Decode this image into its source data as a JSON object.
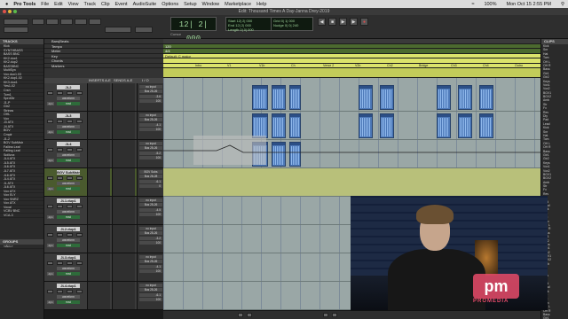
{
  "menubar": {
    "items": [
      "Pro Tools",
      "File",
      "Edit",
      "View",
      "Track",
      "Clip",
      "Event",
      "AudioSuite",
      "Options",
      "Setup",
      "Window",
      "Marketplace",
      "Help"
    ],
    "battery": "100%",
    "clock": "Mon Oct 15 2:55 PM"
  },
  "window": {
    "title": "Edit: Thousand Times A Day-Janna Drey-2019"
  },
  "toolbar": {
    "main_counter": "12| 2| 000",
    "start_label": "Start",
    "end_label": "End",
    "length_label": "Length",
    "start_value": "12| 2| 000",
    "end_value": "12| 2| 000",
    "length_value": "0| 0| 000",
    "grid_label": "Grid",
    "nudge_label": "Nudge",
    "grid_value": "0| 1| 000",
    "nudge_value": "0| 0| 240",
    "cursor_label": "Cursor"
  },
  "tracks_panel": {
    "header": "TRACKS",
    "items": [
      "Kick",
      "SYNTHBASS",
      "BASS BNC",
      "KK2.dup1",
      "KK2.dup2",
      "BASSBNC",
      "MultiSyn",
      "Vox.dup1.03",
      "KK2.dup1.02",
      "KK3.dup1",
      "Yes1-02",
      "Crsh",
      "Tom1",
      "SprdGtr",
      "J1-P",
      "Gtr2",
      "Strings",
      "OHL",
      "Vox",
      "J3 ATX",
      "J4 ATX",
      "BGV",
      "Cmplr",
      "J1-2",
      "BGV SubMstr",
      "Falling Leaf",
      "Falling Leaf",
      "Spillvox",
      "JL4 ATX",
      "JL5 ATX",
      "JL6 ATX",
      "JL7 ATX",
      "JL6 ATX",
      "JL4 ATX",
      "JL ATX",
      "JL6 ATX",
      "Vox ATX",
      "Vox ELY",
      "Vox SNRZ",
      "Vox ATX",
      "Vocal",
      "VCBV BNC",
      "VCA-3"
    ],
    "groups_header": "GROUPS",
    "groups_items": [
      "<ALL>"
    ]
  },
  "clips_panel": {
    "header": "CLIPS",
    "items": [
      "Kick",
      "Snr",
      "Hat",
      "Tom",
      "OH L",
      "OH R",
      "Bass",
      "Gtr1",
      "Gtr2",
      "Keys",
      "Vox1",
      "Vox2",
      "BGV1",
      "BGV2",
      "Amb",
      "Str",
      "Fx",
      "Rev",
      "Dly",
      "Pad",
      "Lead",
      "Kick",
      "Snr",
      "Hat",
      "Tom",
      "OH L",
      "OH R",
      "Bass",
      "Gtr1",
      "Gtr2",
      "Keys",
      "Vox1",
      "Vox2",
      "BGV1",
      "BGV2",
      "Amb",
      "Str",
      "Fx",
      "Rev",
      "Dly",
      "Pad",
      "Lead",
      "Kick",
      "Snr",
      "Hat",
      "Tom",
      "OH L",
      "OH R",
      "Bass",
      "Gtr1",
      "Gtr2",
      "Keys",
      "Vox1",
      "Vox2",
      "BGV1",
      "BGV2",
      "Amb",
      "Str",
      "Fx",
      "Rev",
      "Dly",
      "Pad",
      "Lead",
      "Kick",
      "Snr",
      "Hat",
      "Tom",
      "OH L",
      "OH R",
      "Bass",
      "Gtr1"
    ]
  },
  "rulers": {
    "rows": [
      "Bars|Beats",
      "Tempo",
      "Meter",
      "Key",
      "Chords",
      "Markers"
    ],
    "tempo_value": "120",
    "meter_value": "4/4",
    "key_value": "Default: C major",
    "markers": [
      "Intro",
      "V1",
      "V1b",
      "Ch",
      "Verse 2",
      "V2b",
      "Ch2",
      "Bridge",
      "Ch3",
      "Ch4",
      "Outro"
    ]
  },
  "mixer_headers": {
    "inserts": "INSERTS A-E",
    "sends": "SENDS A-E",
    "io": "I / O"
  },
  "tracks": [
    {
      "name": "JL2",
      "io1": "no input",
      "io2": "Bus 25-26",
      "vol": "-3.6",
      "pan": "100"
    },
    {
      "name": "JL3",
      "io1": "no input",
      "io2": "Bus 25-26",
      "vol": "-4.1",
      "pan": "100"
    },
    {
      "name": "JL4",
      "io1": "no input",
      "io2": "Bus 25-26",
      "vol": "-5.2",
      "pan": "100"
    },
    {
      "name": "BGV SubMstr",
      "io1": "BGV Subs",
      "io2": "Bus 28-28",
      "vol": "-6.1",
      "pan": "0"
    },
    {
      "name": "JL1.dup1",
      "io1": "no input",
      "io2": "Bus 25-26",
      "vol": "-4.5",
      "pan": "100"
    },
    {
      "name": "JL2.dup1",
      "io1": "no input",
      "io2": "Bus 25-26",
      "vol": "-3.2",
      "pan": "100"
    },
    {
      "name": "JL3.dup1",
      "io1": "no input",
      "io2": "Bus 25-26",
      "vol": "-4.1",
      "pan": "100"
    },
    {
      "name": "JL4.dup1",
      "io1": "no input",
      "io2": "Bus 25-26",
      "vol": "-6.1",
      "pan": "100"
    }
  ],
  "track_sub": {
    "waveform": "waveform",
    "volume": "volume",
    "dyn": "dyn",
    "read": "read"
  },
  "watermark": {
    "brand": "PROMEDIA"
  },
  "colors": {
    "clip": "#4d79b8",
    "edit_bg": "#9aa7a6",
    "selected": "#dce36b",
    "brand": "#e84b6a"
  }
}
